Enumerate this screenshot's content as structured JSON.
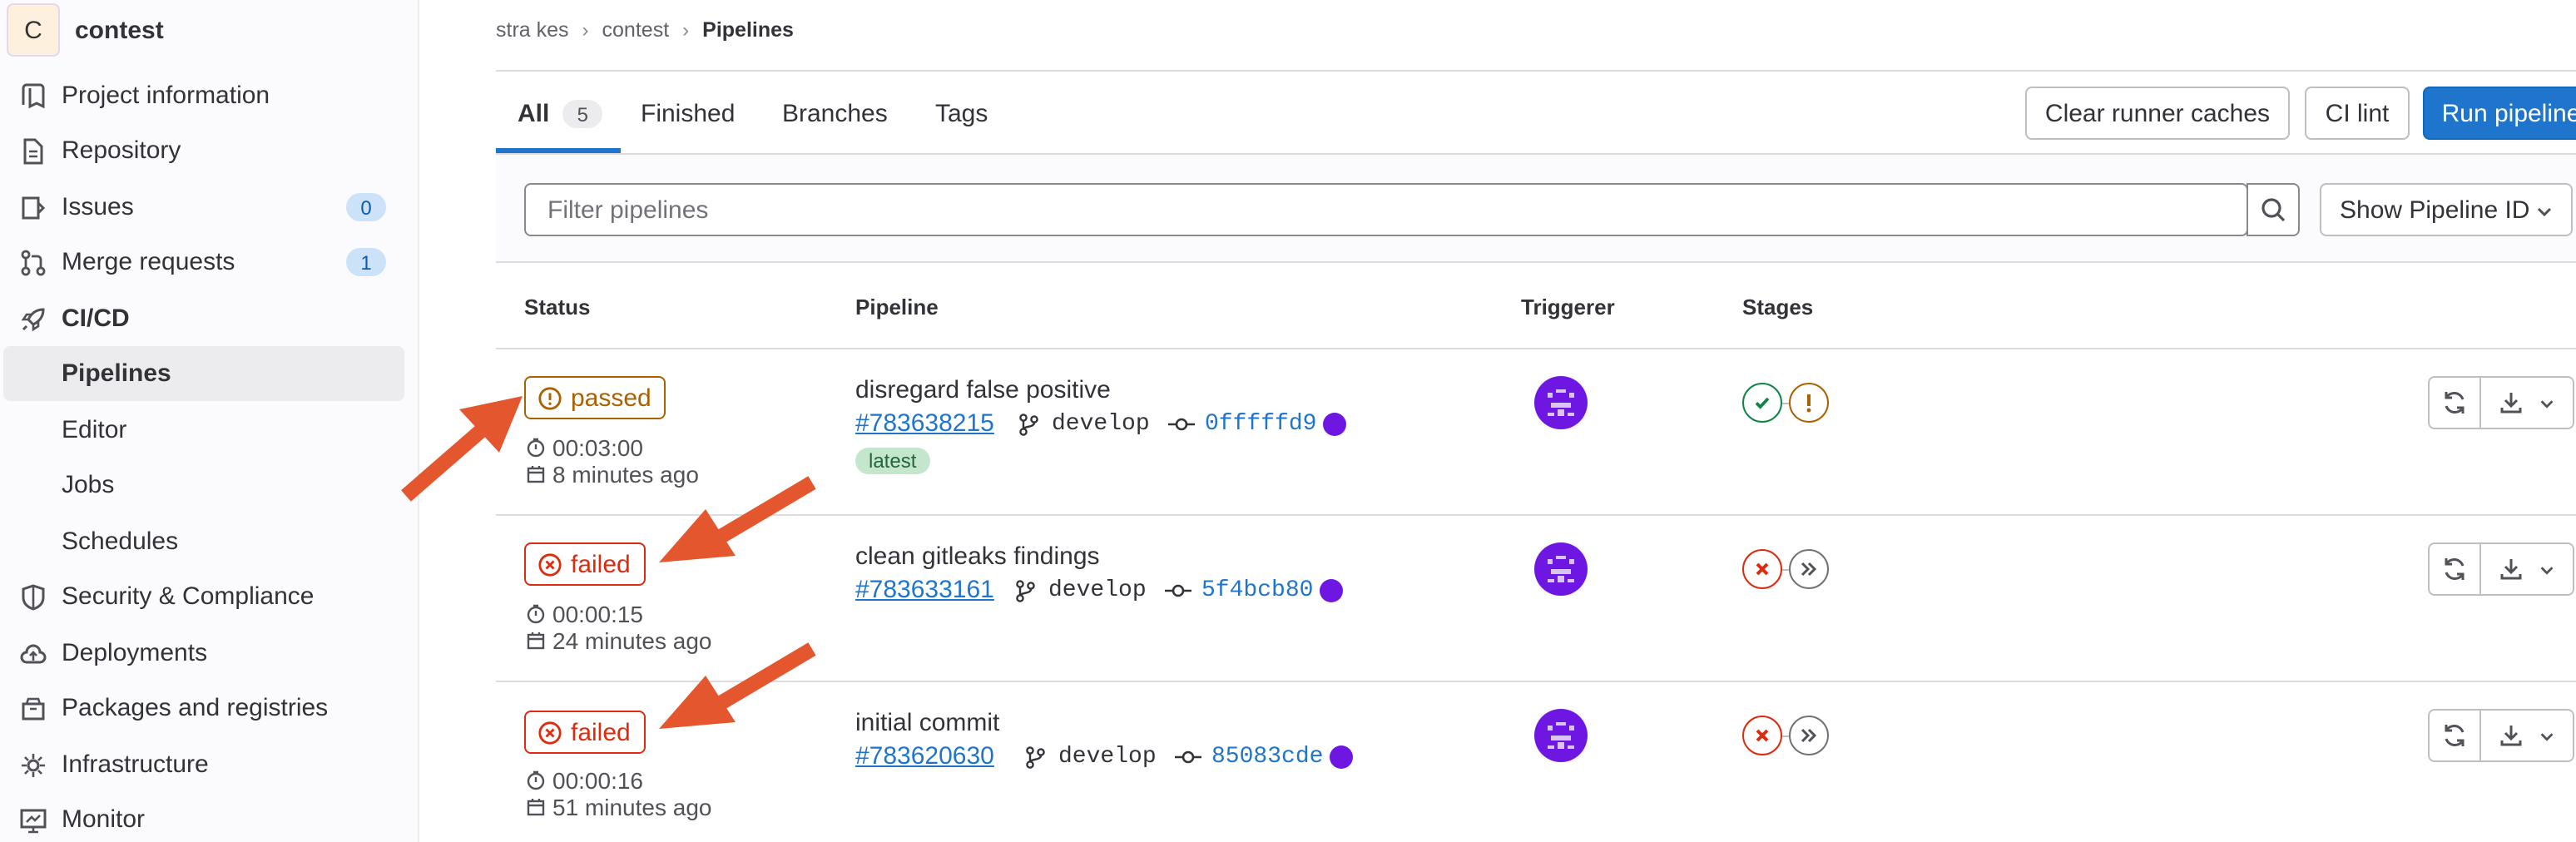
{
  "sidebar": {
    "project_initial": "C",
    "project_name": "contest",
    "items": [
      {
        "label": "Project information"
      },
      {
        "label": "Repository"
      },
      {
        "label": "Issues",
        "count": "0"
      },
      {
        "label": "Merge requests",
        "count": "1"
      },
      {
        "label": "CI/CD"
      },
      {
        "label": "Pipelines"
      },
      {
        "label": "Editor"
      },
      {
        "label": "Jobs"
      },
      {
        "label": "Schedules"
      },
      {
        "label": "Security & Compliance"
      },
      {
        "label": "Deployments"
      },
      {
        "label": "Packages and registries"
      },
      {
        "label": "Infrastructure"
      },
      {
        "label": "Monitor"
      }
    ]
  },
  "breadcrumb": {
    "group": "stra kes",
    "project": "contest",
    "current": "Pipelines"
  },
  "tabs": [
    {
      "label": "All",
      "count": "5"
    },
    {
      "label": "Finished"
    },
    {
      "label": "Branches"
    },
    {
      "label": "Tags"
    }
  ],
  "buttons": {
    "clear_caches": "Clear runner caches",
    "ci_lint": "CI lint",
    "run_pipeline": "Run pipeline"
  },
  "filter": {
    "placeholder": "Filter pipelines",
    "select_label": "Show Pipeline ID"
  },
  "table": {
    "headers": {
      "status": "Status",
      "pipeline": "Pipeline",
      "triggerer": "Triggerer",
      "stages": "Stages"
    },
    "rows": [
      {
        "status": "passed",
        "duration": "00:03:00",
        "finished": "8 minutes ago",
        "title": "disregard false positive",
        "id": "#783638215",
        "branch": "develop",
        "sha": "0fffffd9",
        "badge": "latest",
        "stages": [
          "success",
          "warning"
        ]
      },
      {
        "status": "failed",
        "duration": "00:00:15",
        "finished": "24 minutes ago",
        "title": "clean gitleaks findings",
        "id": "#783633161",
        "branch": "develop",
        "sha": "5f4bcb80",
        "stages": [
          "failed",
          "skipped"
        ]
      },
      {
        "status": "failed",
        "duration": "00:00:16",
        "finished": "51 minutes ago",
        "title": "initial commit",
        "id": "#783620630",
        "branch": "develop",
        "sha": "85083cde",
        "stages": [
          "failed",
          "skipped"
        ]
      }
    ]
  },
  "colors": {
    "accent": "#1f75cb",
    "warning": "#ab6100",
    "danger": "#dd2b0e",
    "success": "#108548",
    "annotation_arrow": "#e4572e",
    "avatar": "#6e17e3"
  }
}
